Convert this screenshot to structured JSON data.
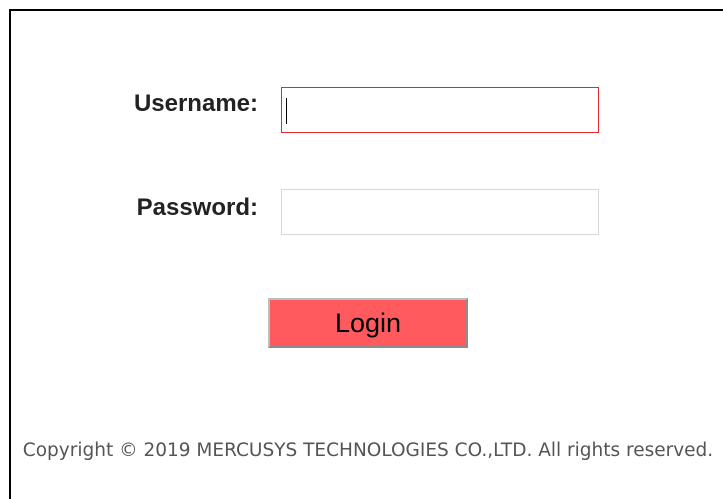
{
  "login_form": {
    "username_label": "Username:",
    "username_value": "",
    "password_label": "Password:",
    "password_value": "",
    "login_button_label": "Login"
  },
  "footer": {
    "copyright_text": "Copyright © 2019 MERCUSYS TECHNOLOGIES CO.,LTD. All rights reserved."
  },
  "colors": {
    "login_button_bg": "#ff5b5f",
    "focused_field_border": "#e0282e",
    "idle_field_border": "#d8d8d8"
  }
}
